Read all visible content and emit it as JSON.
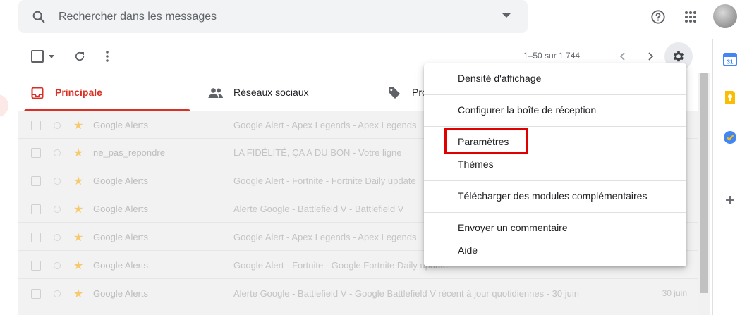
{
  "search": {
    "placeholder": "Rechercher dans les messages"
  },
  "header": {
    "icons": [
      "help-icon",
      "apps-icon",
      "avatar"
    ]
  },
  "toolbar": {
    "pagination": "1–50 sur 1 744",
    "icons": [
      "select-checkbox",
      "refresh-icon",
      "more-vert-icon",
      "chevron-left-icon",
      "chevron-right-icon",
      "gear-icon"
    ]
  },
  "tabs": [
    {
      "label": "Principale",
      "active": true,
      "icon": "inbox-icon"
    },
    {
      "label": "Réseaux sociaux",
      "active": false,
      "icon": "people-icon"
    },
    {
      "label": "Pro",
      "active": false,
      "icon": "tag-icon"
    }
  ],
  "settings_menu": {
    "items": [
      {
        "label": "Densité d'affichage"
      },
      {
        "label": "Configurer la boîte de réception"
      },
      {
        "label": "Paramètres",
        "highlighted": true
      },
      {
        "label": "Thèmes"
      },
      {
        "label": "Télécharger des modules complémentaires"
      },
      {
        "label": "Envoyer un commentaire"
      },
      {
        "label": "Aide"
      }
    ]
  },
  "emails": [
    {
      "sender": "Google Alerts",
      "subject": "Google Alert - Apex Legends - Apex Legends",
      "date": ""
    },
    {
      "sender": "ne_pas_repondre",
      "subject": "LA FIDÉLITÉ, ÇA A DU BON - Votre ligne",
      "date": ""
    },
    {
      "sender": "Google Alerts",
      "subject": "Google Alert - Fortnite - Fortnite Daily update",
      "date": ""
    },
    {
      "sender": "Google Alerts",
      "subject": "Alerte Google - Battlefield V - Battlefield V",
      "date": ""
    },
    {
      "sender": "Google Alerts",
      "subject": "Google Alert - Apex Legends - Apex Legends",
      "date": ""
    },
    {
      "sender": "Google Alerts",
      "subject": "Google Alert - Fortnite - Google Fortnite Daily update",
      "date": ""
    },
    {
      "sender": "Google Alerts",
      "subject": "Alerte Google - Battlefield V - Google Battlefield V récent à jour quotidiennes - 30 juin",
      "date": "30 juin"
    }
  ],
  "side_panel": {
    "icons": [
      "calendar-icon",
      "keep-icon",
      "tasks-icon",
      "add-icon"
    ]
  },
  "colors": {
    "accent": "#d93025",
    "highlight_box": "#e00000",
    "menu_bg": "#ffffff"
  }
}
